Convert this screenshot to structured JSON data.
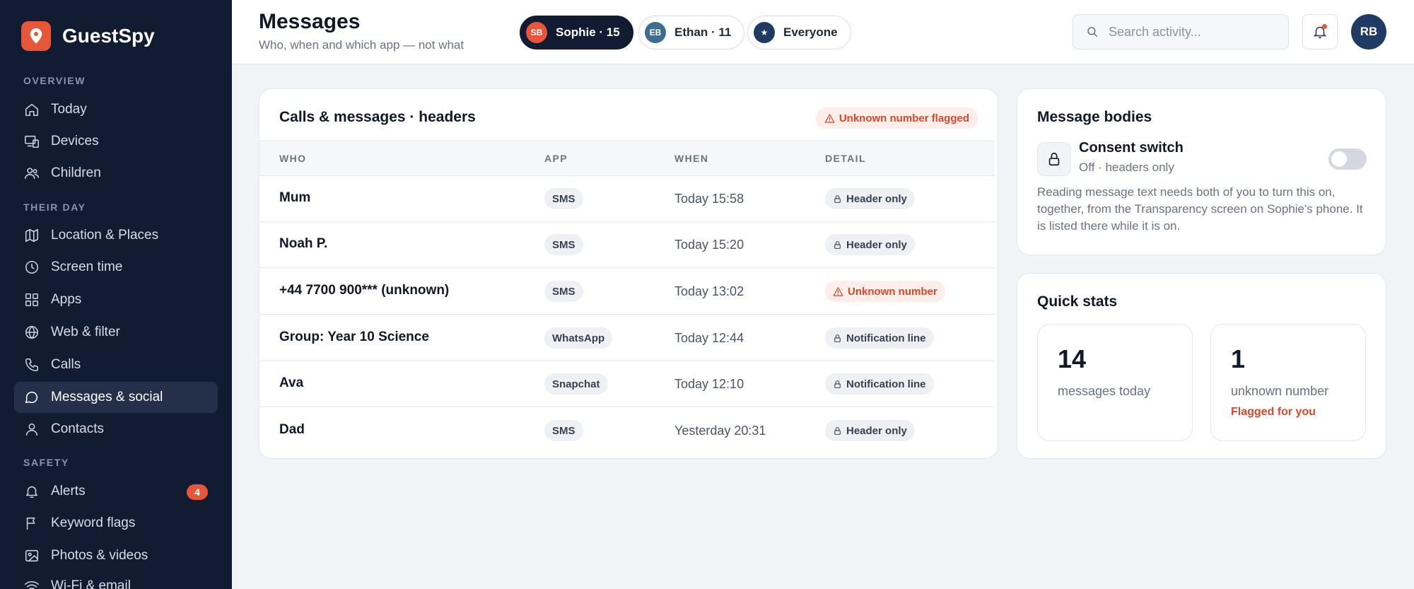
{
  "brand": {
    "name": "GuestSpy",
    "logo_icon": "map-pin-icon"
  },
  "sidebar": {
    "sections": [
      {
        "label": "OVERVIEW"
      },
      {
        "label": "THEIR DAY"
      },
      {
        "label": "SAFETY"
      }
    ],
    "items": [
      {
        "label": "Today",
        "icon": "home-icon"
      },
      {
        "label": "Devices",
        "icon": "devices-icon"
      },
      {
        "label": "Children",
        "icon": "users-icon"
      },
      {
        "label": "Location & Places",
        "icon": "map-icon"
      },
      {
        "label": "Screen time",
        "icon": "clock-icon"
      },
      {
        "label": "Apps",
        "icon": "grid-icon"
      },
      {
        "label": "Web & filter",
        "icon": "globe-icon"
      },
      {
        "label": "Calls",
        "icon": "phone-icon"
      },
      {
        "label": "Messages & social",
        "icon": "chat-icon",
        "active": true
      },
      {
        "label": "Contacts",
        "icon": "user-icon"
      },
      {
        "label": "Alerts",
        "icon": "bell-icon",
        "badge": "4"
      },
      {
        "label": "Keyword flags",
        "icon": "flag-icon"
      },
      {
        "label": "Photos & videos",
        "icon": "image-icon"
      },
      {
        "label": "Wi-Fi & email",
        "icon": "wifi-icon"
      }
    ]
  },
  "header": {
    "title": "Messages",
    "subtitle": "Who, when and which app — not what",
    "chips": [
      {
        "initials": "SB",
        "label": "Sophie · 15",
        "active": true,
        "color": "#e8563a"
      },
      {
        "initials": "EB",
        "label": "Ethan · 11",
        "active": false,
        "color": "#3d6e8f"
      },
      {
        "initials": "★",
        "label": "Everyone",
        "active": false,
        "color": "#1f3a63"
      }
    ],
    "search_placeholder": "Search activity...",
    "avatar_initials": "RB"
  },
  "messages_card": {
    "title": "Calls & messages · headers",
    "flag": "Unknown number flagged",
    "columns": [
      "WHO",
      "APP",
      "WHEN",
      "DETAIL"
    ],
    "rows": [
      {
        "who": "Mum",
        "app": "SMS",
        "when": "Today 15:58",
        "detail": "Header only",
        "warn": false
      },
      {
        "who": "Noah P.",
        "app": "SMS",
        "when": "Today 15:20",
        "detail": "Header only",
        "warn": false
      },
      {
        "who": "+44 7700 900*** (unknown)",
        "app": "SMS",
        "when": "Today 13:02",
        "detail": "Unknown number",
        "warn": true
      },
      {
        "who": "Group: Year 10 Science",
        "app": "WhatsApp",
        "when": "Today 12:44",
        "detail": "Notification line",
        "warn": false
      },
      {
        "who": "Ava",
        "app": "Snapchat",
        "when": "Today 12:10",
        "detail": "Notification line",
        "warn": false
      },
      {
        "who": "Dad",
        "app": "SMS",
        "when": "Yesterday 20:31",
        "detail": "Header only",
        "warn": false
      }
    ]
  },
  "bodies_card": {
    "title": "Message bodies",
    "consent_title": "Consent switch",
    "consent_status": "Off · headers only",
    "toggle_on": false,
    "description": "Reading message text needs both of you to turn this on, together, from the Transparency screen on Sophie's phone. It is listed there while it is on."
  },
  "stats_card": {
    "title": "Quick stats",
    "stats": [
      {
        "value": "14",
        "label": "messages today",
        "note": ""
      },
      {
        "value": "1",
        "label": "unknown number",
        "note": "Flagged for you"
      }
    ]
  },
  "colors": {
    "accent": "#e8563a",
    "sidebar_bg": "#111c33",
    "warn": "#d9482b"
  }
}
